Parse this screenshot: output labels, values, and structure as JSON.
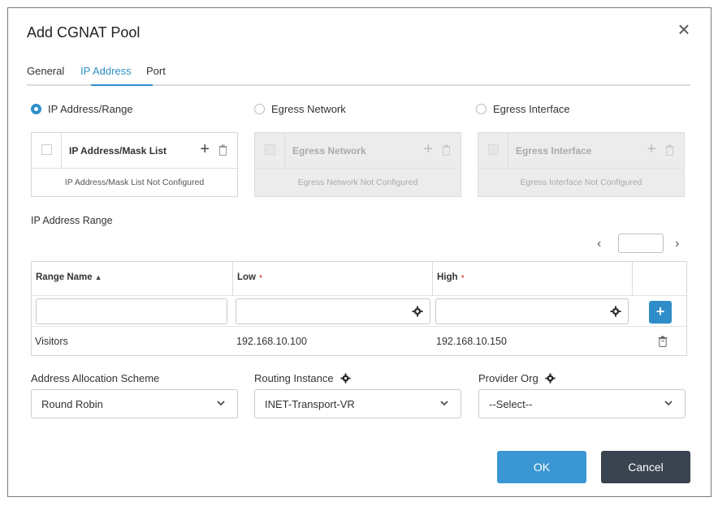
{
  "dialog": {
    "title": "Add CGNAT Pool",
    "close_glyph": "×"
  },
  "tabs": [
    {
      "label": "General",
      "active": false
    },
    {
      "label": "IP Address",
      "active": true
    },
    {
      "label": "Port",
      "active": false
    }
  ],
  "source_options": [
    {
      "label": "IP Address/Range",
      "checked": true
    },
    {
      "label": "Egress Network",
      "checked": false
    },
    {
      "label": "Egress Interface",
      "checked": false
    }
  ],
  "panels": [
    {
      "header": "IP Address/Mask List",
      "empty": "IP Address/Mask List Not Configured",
      "enabled": true
    },
    {
      "header": "Egress Network",
      "empty": "Egress Network Not Configured",
      "enabled": false
    },
    {
      "header": "Egress Interface",
      "empty": "Egress Interface Not Configured",
      "enabled": false
    }
  ],
  "range_section": {
    "title": "IP Address Range",
    "pager": {
      "prev": "‹",
      "next": "›",
      "page": ""
    },
    "columns": [
      {
        "label": "Range Name",
        "sort": "▲",
        "required": false
      },
      {
        "label": "Low",
        "required": true
      },
      {
        "label": "High",
        "required": true
      }
    ],
    "required_marker": "•",
    "add_label": "+",
    "rows": [
      {
        "name": "Visitors",
        "low": "192.168.10.100",
        "high": "192.168.10.150"
      }
    ]
  },
  "fields": {
    "allocation": {
      "label": "Address Allocation Scheme",
      "value": "Round Robin"
    },
    "routing": {
      "label": "Routing Instance",
      "value": "INET-Transport-VR"
    },
    "provider": {
      "label": "Provider Org",
      "value": "--Select--"
    }
  },
  "actions": {
    "ok": "OK",
    "cancel": "Cancel"
  },
  "colors": {
    "accent": "#2f8ec9",
    "ok": "#3b97d3",
    "cancel": "#3a4350",
    "required": "#e06a6a"
  },
  "icons": [
    "close-icon",
    "plus-icon",
    "trash-icon",
    "gear-icon",
    "chevron-down-icon",
    "chevron-left-icon",
    "chevron-right-icon",
    "sort-asc-icon"
  ]
}
